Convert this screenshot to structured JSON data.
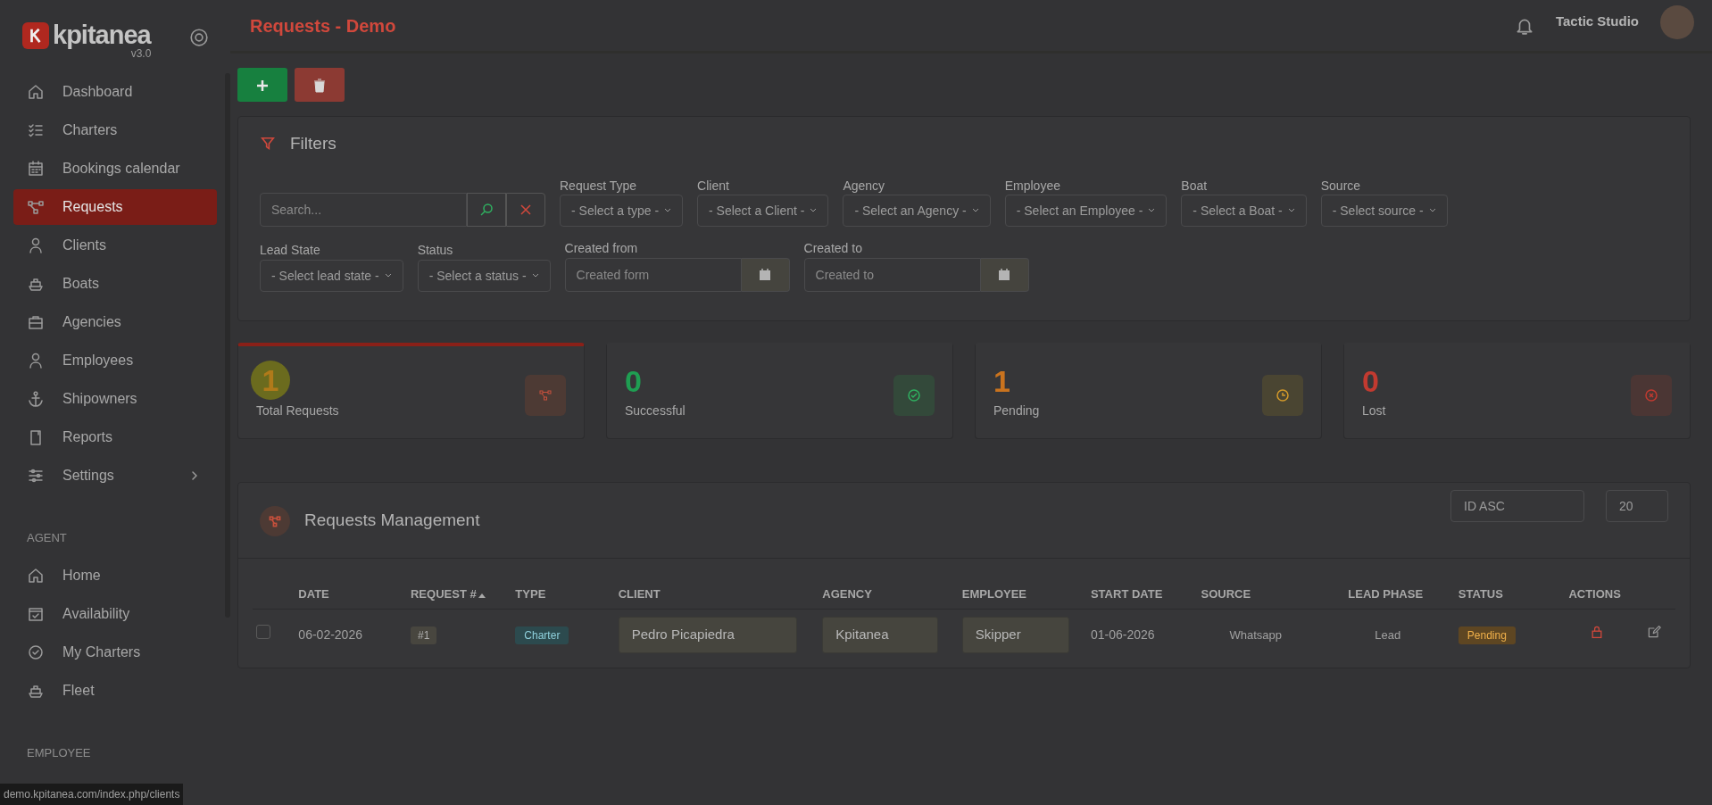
{
  "sidebar": {
    "logo_text": "kpitanea",
    "version": "v3.0",
    "sections": [
      {
        "items": [
          {
            "label": "Dashboard",
            "selected": false,
            "expandable": false
          },
          {
            "label": "Charters",
            "selected": false,
            "expandable": false
          },
          {
            "label": "Bookings calendar",
            "selected": false,
            "expandable": false
          },
          {
            "label": "Requests",
            "selected": true,
            "expandable": false
          },
          {
            "label": "Clients",
            "selected": false,
            "expandable": false
          },
          {
            "label": "Boats",
            "selected": false,
            "expandable": false
          },
          {
            "label": "Agencies",
            "selected": false,
            "expandable": false
          },
          {
            "label": "Employees",
            "selected": false,
            "expandable": false
          },
          {
            "label": "Shipowners",
            "selected": false,
            "expandable": false
          },
          {
            "label": "Reports",
            "selected": false,
            "expandable": false
          },
          {
            "label": "Settings",
            "selected": false,
            "expandable": true
          }
        ]
      },
      {
        "heading": "AGENT",
        "items": [
          {
            "label": "Home",
            "selected": false,
            "expandable": false
          },
          {
            "label": "Availability",
            "selected": false,
            "expandable": false
          },
          {
            "label": "My Charters",
            "selected": false,
            "expandable": false
          },
          {
            "label": "Fleet",
            "selected": false,
            "expandable": false
          }
        ]
      },
      {
        "heading": "EMPLOYEE"
      }
    ]
  },
  "header": {
    "title": "Requests - Demo",
    "user_name": "Tactic Studio"
  },
  "filters": {
    "title": "Filters",
    "search": {
      "placeholder": "Search..."
    },
    "lines": [
      {
        "fields": [
          {
            "kind": "select",
            "label": "Request Type",
            "placeholder": "- Select a type -"
          },
          {
            "kind": "select",
            "label": "Client",
            "placeholder": "- Select a Client -"
          },
          {
            "kind": "select",
            "label": "Agency",
            "placeholder": "- Select an Agency -"
          },
          {
            "kind": "select",
            "label": "Employee",
            "placeholder": "- Select an Employee -"
          },
          {
            "kind": "select",
            "label": "Boat",
            "placeholder": "- Select a Boat -"
          },
          {
            "kind": "select",
            "label": "Source",
            "placeholder": "- Select source -"
          }
        ]
      },
      {
        "fields": [
          {
            "kind": "select",
            "label": "Lead State",
            "placeholder": "- Select lead state -"
          },
          {
            "kind": "select",
            "label": "Status",
            "placeholder": "- Select a status -"
          },
          {
            "kind": "date",
            "label": "Created from",
            "placeholder": "Created form"
          },
          {
            "kind": "date",
            "label": "Created to",
            "placeholder": "Created to"
          }
        ]
      }
    ]
  },
  "stats": [
    {
      "value": "1",
      "label": "Total Requests",
      "selected": true,
      "color": "#b07a1a"
    },
    {
      "value": "0",
      "label": "Successful",
      "selected": false,
      "color": "#1f9e52"
    },
    {
      "value": "1",
      "label": "Pending",
      "selected": false,
      "color": "#c9731e"
    },
    {
      "value": "0",
      "label": "Lost",
      "selected": false,
      "color": "#c23a30"
    }
  ],
  "table": {
    "title": "Requests Management",
    "sort": "ID ASC",
    "page_size": "20",
    "columns": [
      "DATE",
      "REQUEST #",
      "TYPE",
      "CLIENT",
      "AGENCY",
      "EMPLOYEE",
      "START DATE",
      "SOURCE",
      "LEAD PHASE",
      "STATUS",
      "ACTIONS"
    ],
    "rows": [
      {
        "checked": false,
        "date": "06-02-2026",
        "request": "#1",
        "type": "Charter",
        "client": "Pedro Picapiedra",
        "agency": "Kpitanea",
        "employee": "Skipper",
        "start_date": "01-06-2026",
        "source": "Whatsapp",
        "lead_phase": "Lead",
        "status": "Pending"
      }
    ]
  },
  "status_url": "demo.kpitanea.com/index.php/clients"
}
